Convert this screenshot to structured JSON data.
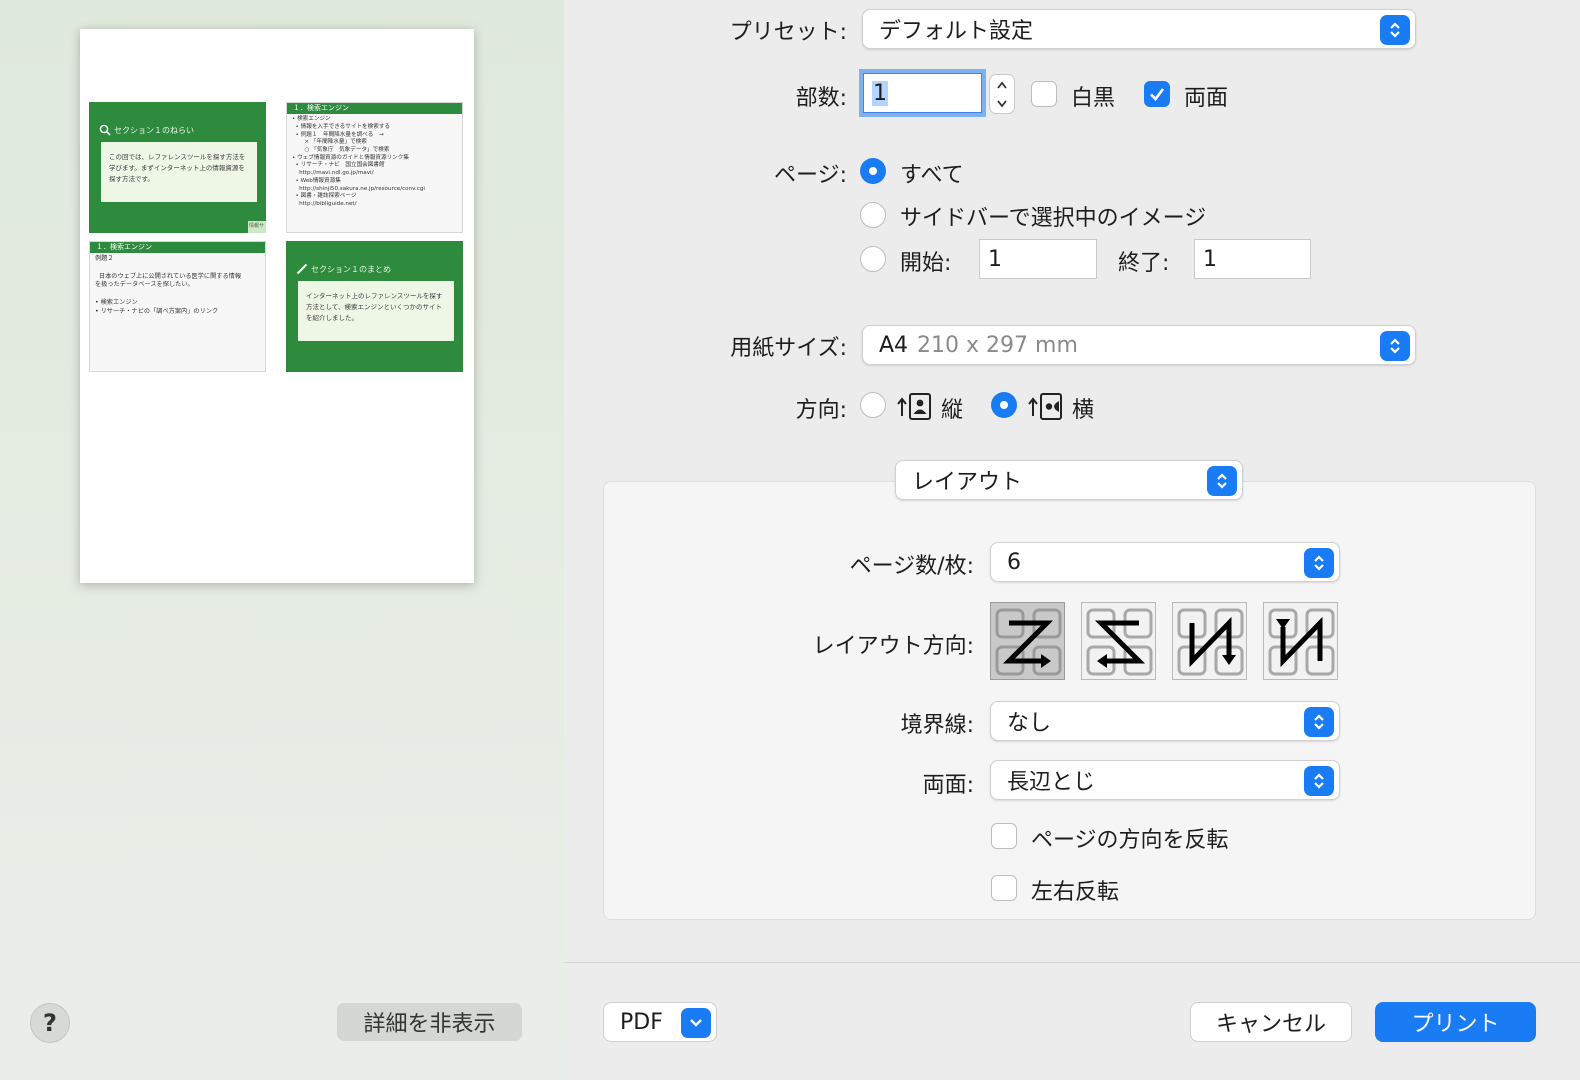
{
  "preview": {
    "slides": [
      {
        "title": "セクション１のねらい",
        "body": "この回では、レファレンスツールを探す方法を学びます。まずインターネット上の情報資源を探す方法です。",
        "footer": "情報サ"
      },
      {
        "title": "１．検索エンジン",
        "body": "• 検索エンジン\n  • 情報を入手できるサイトを検索する\n  • 例題１　年間降水量を調べる　→\n       × 「年間降水量」で検索\n       ○ 「気象庁　気象データ」で検索\n• ウェブ情報資源のガイドと情報資源リンク集\n  • リサーチ・ナビ　国立国会図書館\n    http://mavi.ndl.go.jp/mavi/\n  • Web情報資源集\n    http://shinji50.sakura.ne.jp/resource/conv.cgi\n  • 図書・雑誌探索ページ\n    http://bibliguide.net/"
      },
      {
        "title": "１．検索エンジン",
        "body": "例題２\n\n  日本のウェブ上に公開されている医学に関する情報\nを扱ったデータベースを探したい。\n\n• 検索エンジン\n• リサーチ・ナビの「調べ方案内」のリンク"
      },
      {
        "title": "セクション１のまとめ",
        "body": "インターネット上のレファレンスツールを探す方法として、検索エンジンといくつかのサイトを紹介しました。"
      }
    ]
  },
  "help_label": "?",
  "hide_details_label": "詳細を非表示",
  "preset": {
    "label": "プリセット:",
    "value": "デフォルト設定"
  },
  "copies": {
    "label": "部数:",
    "value": "1",
    "bw_label": "白黒",
    "bw_checked": false,
    "duplex_label": "両面",
    "duplex_checked": true
  },
  "pages": {
    "label": "ページ:",
    "all_label": "すべて",
    "sidebar_label": "サイドバーで選択中のイメージ",
    "from_label": "開始:",
    "from_value": "1",
    "to_label": "終了:",
    "to_value": "1",
    "selected": "all"
  },
  "paper_size": {
    "label": "用紙サイズ:",
    "value_main": "A4",
    "value_dim": "210 x 297 mm"
  },
  "orientation": {
    "label": "方向:",
    "portrait_label": "縦",
    "landscape_label": "横",
    "selected": "landscape"
  },
  "section_popup": {
    "value": "レイアウト"
  },
  "layout": {
    "pages_per_sheet_label": "ページ数/枚:",
    "pages_per_sheet_value": "6",
    "direction_label": "レイアウト方向:",
    "directions": [
      "Z",
      "reverse-Z",
      "reverse-N",
      "N"
    ],
    "direction_selected": 0,
    "border_label": "境界線:",
    "border_value": "なし",
    "duplex_label": "両面:",
    "duplex_value": "長辺とじ",
    "reverse_orientation_label": "ページの方向を反転",
    "flip_horizontal_label": "左右反転"
  },
  "footer": {
    "pdf_label": "PDF",
    "cancel_label": "キャンセル",
    "print_label": "プリント"
  },
  "colors": {
    "accent": "#1a7cf5",
    "slide_green": "#2e8b3e"
  }
}
